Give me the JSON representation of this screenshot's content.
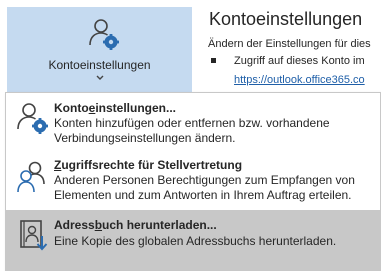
{
  "account_tile": {
    "label": "Kontoeinstellungen",
    "icon": "account-settings-icon"
  },
  "page": {
    "heading": "Kontoeinstellungen",
    "description": "Ändern der Einstellungen für dies",
    "bullet_text": "Zugriff auf dieses Konto im",
    "bullet_link": "https://outlook.office365.co"
  },
  "menu": {
    "items": [
      {
        "title_pre": "Konto",
        "title_key": "e",
        "title_post": "instellungen...",
        "desc_line1": "Konten hinzufügen oder entfernen bzw. vorhandene",
        "desc_line2": "Verbindungseinstellungen ändern.",
        "icon": "account-settings-icon"
      },
      {
        "title_pre": "",
        "title_key": "Z",
        "title_post": "ugriffsrechte für Stellvertretung",
        "desc_line1": "Anderen Personen Berechtigungen zum Empfangen von",
        "desc_line2": "Elementen und zum Antworten in Ihrem Auftrag erteilen.",
        "icon": "delegate-access-icon"
      },
      {
        "title_pre": "Adress",
        "title_key": "b",
        "title_post": "uch herunterladen...",
        "desc_line1": "Eine Kopie des globalen Adressbuchs herunterladen.",
        "desc_line2": "",
        "icon": "address-book-download-icon"
      }
    ]
  },
  "colors": {
    "tile_bg": "#c5daf0",
    "highlight_bg": "#c8c8c8",
    "icon_blue": "#2b6cb0"
  }
}
